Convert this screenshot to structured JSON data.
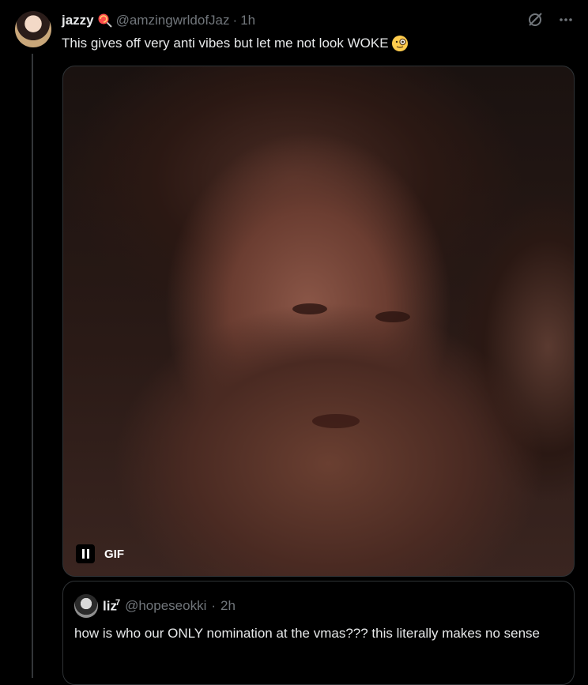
{
  "tweet": {
    "name": "jazzy",
    "handle": "@amzingwrldofJaz",
    "separator": "·",
    "time": "1h",
    "text": "This gives off very anti vibes but let me not look WOKE"
  },
  "media": {
    "badge": "GIF"
  },
  "quote": {
    "name": "liz",
    "name_sup": "7",
    "handle": "@hopeseokki",
    "separator": "·",
    "time": "2h",
    "text": "how is who our ONLY nomination at the vmas??? this literally makes no sense"
  },
  "icons": {
    "grok": "grok-icon",
    "more": "more-icon",
    "lollipop": "lollipop-emoji",
    "monocle": "monocle-face-emoji",
    "pause": "pause-icon"
  },
  "colors": {
    "background": "#000000",
    "text": "#e7e9ea",
    "muted": "#71767b",
    "border": "#2f3336"
  }
}
